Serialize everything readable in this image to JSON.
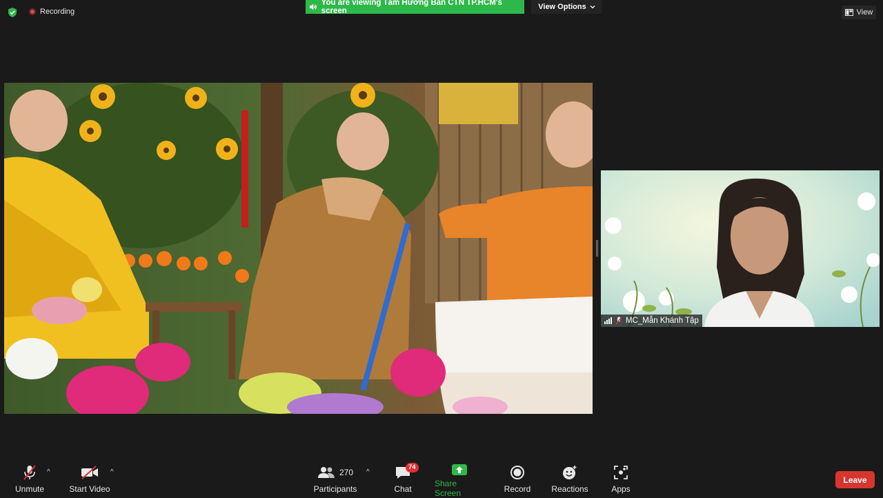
{
  "top": {
    "recording_label": "Recording",
    "banner_text": "You are viewing Tâm Hương Bản CTN TP.HCM's screen",
    "view_options_label": "View Options",
    "view_label": "View"
  },
  "participant": {
    "name": "MC_Mẫn Khánh Tập"
  },
  "toolbar": {
    "unmute_label": "Unmute",
    "start_video_label": "Start Video",
    "participants_label": "Participants",
    "participants_count": "270",
    "chat_label": "Chat",
    "chat_badge": "74",
    "share_screen_label": "Share Screen",
    "record_label": "Record",
    "reactions_label": "Reactions",
    "apps_label": "Apps",
    "leave_label": "Leave"
  },
  "colors": {
    "background": "#1a1a1a",
    "banner_green": "#2eb84a",
    "leave_red": "#d7362e",
    "share_green": "#2eb84a",
    "badge_red": "#e02f2f"
  },
  "icons": [
    "shield-check-icon",
    "recording-dot-icon",
    "speaker-icon",
    "chevron-down-icon",
    "view-grid-icon",
    "signal-bars-icon",
    "muted-mic-icon",
    "mic-off-icon",
    "video-off-icon",
    "participants-icon",
    "chat-icon",
    "share-screen-icon",
    "record-icon",
    "reactions-icon",
    "apps-icon"
  ]
}
